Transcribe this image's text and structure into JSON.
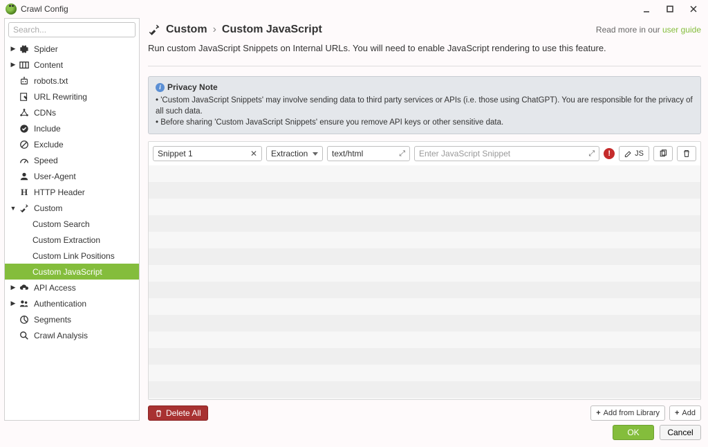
{
  "window": {
    "title": "Crawl Config"
  },
  "search": {
    "placeholder": "Search..."
  },
  "sidebar": {
    "items": [
      {
        "label": "Spider",
        "expandable": true
      },
      {
        "label": "Content",
        "expandable": true
      },
      {
        "label": "robots.txt"
      },
      {
        "label": "URL Rewriting"
      },
      {
        "label": "CDNs"
      },
      {
        "label": "Include"
      },
      {
        "label": "Exclude"
      },
      {
        "label": "Speed"
      },
      {
        "label": "User-Agent"
      },
      {
        "label": "HTTP Header"
      },
      {
        "label": "Custom",
        "expandable": true,
        "expanded": true
      },
      {
        "label": "Custom Search",
        "child": true
      },
      {
        "label": "Custom Extraction",
        "child": true
      },
      {
        "label": "Custom Link Positions",
        "child": true
      },
      {
        "label": "Custom JavaScript",
        "child": true,
        "active": true
      },
      {
        "label": "API Access",
        "expandable": true
      },
      {
        "label": "Authentication",
        "expandable": true
      },
      {
        "label": "Segments"
      },
      {
        "label": "Crawl Analysis"
      }
    ]
  },
  "header": {
    "bc_parent": "Custom",
    "bc_sep": "›",
    "bc_current": "Custom JavaScript",
    "readmore_prefix": "Read more in our ",
    "readmore_link": "user guide"
  },
  "description": "Run custom JavaScript Snippets on Internal URLs. You will need to enable JavaScript rendering to use this feature.",
  "privacy": {
    "title": "Privacy Note",
    "line1": "• 'Custom JavaScript Snippets' may involve sending data to third party services or APIs (i.e. those using ChatGPT). You are responsible for the privacy of all such data.",
    "line2": "• Before sharing 'Custom JavaScript Snippets' ensure you remove API keys or other sensitive data."
  },
  "snippet": {
    "name": "Snippet 1",
    "mode": "Extraction",
    "mime": "text/html",
    "placeholder": "Enter JavaScript Snippet",
    "js_label": "JS"
  },
  "buttons": {
    "delete_all": "Delete All",
    "add_library": "Add from Library",
    "add": "Add",
    "ok": "OK",
    "cancel": "Cancel"
  }
}
